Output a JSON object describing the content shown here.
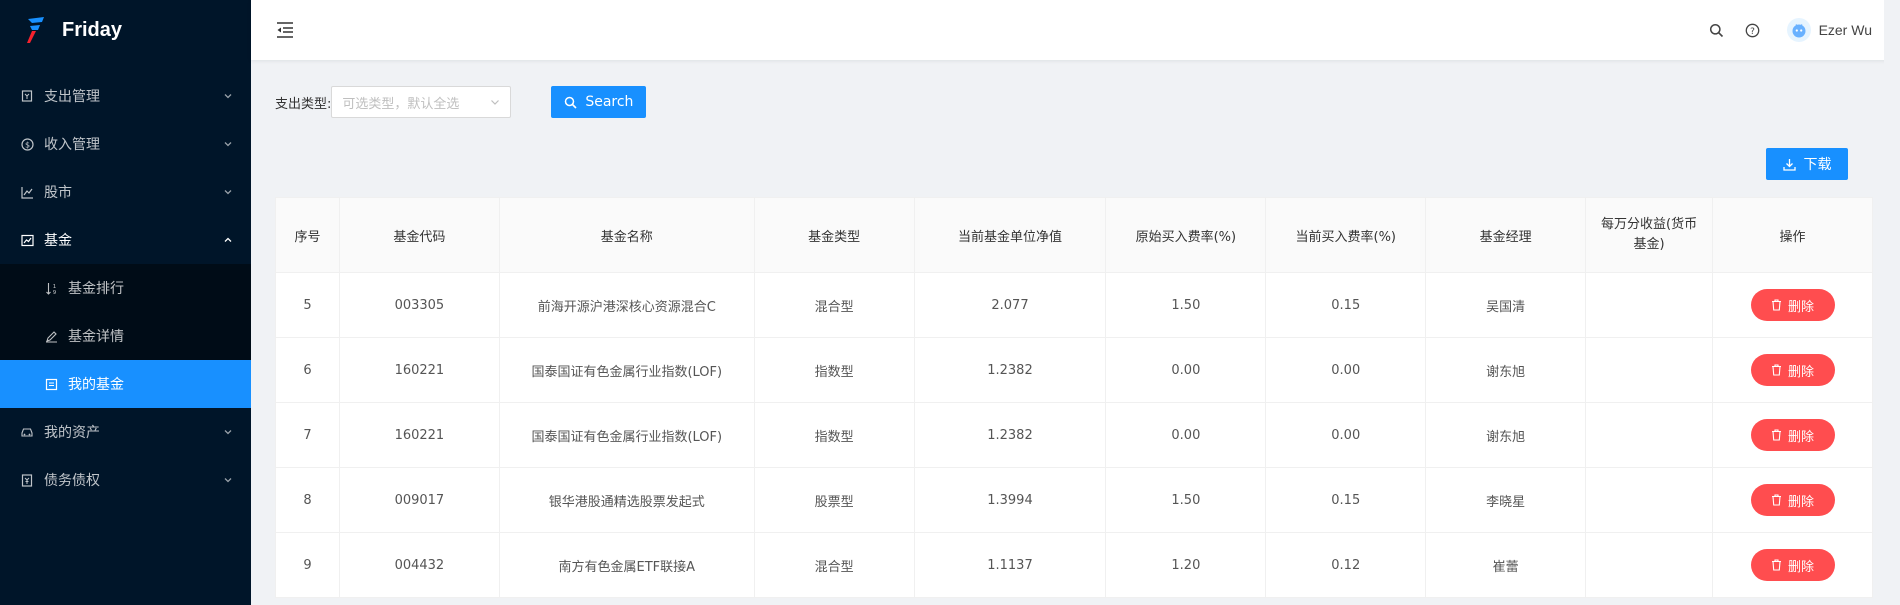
{
  "app": {
    "name": "Friday"
  },
  "sidebar": {
    "items": [
      {
        "label": "支出管理",
        "icon": "receipt-icon"
      },
      {
        "label": "收入管理",
        "icon": "dollar-circle-icon"
      },
      {
        "label": "股市",
        "icon": "line-chart-icon"
      },
      {
        "label": "基金",
        "icon": "fund-chart-icon",
        "open": true,
        "children": [
          {
            "label": "基金排行",
            "icon": "sort-icon"
          },
          {
            "label": "基金详情",
            "icon": "edit-icon"
          },
          {
            "label": "我的基金",
            "icon": "profile-icon",
            "active": true
          }
        ]
      },
      {
        "label": "我的资产",
        "icon": "car-icon"
      },
      {
        "label": "债务债权",
        "icon": "account-book-icon"
      }
    ]
  },
  "header": {
    "user_name": "Ezer Wu"
  },
  "filter": {
    "label": "支出类型:",
    "placeholder": "可选类型，默认全选",
    "search_label": "Search"
  },
  "download_label": "下载",
  "table": {
    "columns": [
      "序号",
      "基金代码",
      "基金名称",
      "基金类型",
      "当前基金单位净值",
      "原始买入费率(%)",
      "当前买入费率(%)",
      "基金经理",
      "每万分收益(货币基金)",
      "操作"
    ],
    "delete_label": "删除",
    "rows": [
      {
        "index": "5",
        "code": "003305",
        "name": "前海开源沪港深核心资源混合C",
        "type": "混合型",
        "nav": "2.077",
        "orig_fee": "1.50",
        "cur_fee": "0.15",
        "manager": "吴国清",
        "yield": ""
      },
      {
        "index": "6",
        "code": "160221",
        "name": "国泰国证有色金属行业指数(LOF)",
        "type": "指数型",
        "nav": "1.2382",
        "orig_fee": "0.00",
        "cur_fee": "0.00",
        "manager": "谢东旭",
        "yield": ""
      },
      {
        "index": "7",
        "code": "160221",
        "name": "国泰国证有色金属行业指数(LOF)",
        "type": "指数型",
        "nav": "1.2382",
        "orig_fee": "0.00",
        "cur_fee": "0.00",
        "manager": "谢东旭",
        "yield": ""
      },
      {
        "index": "8",
        "code": "009017",
        "name": "银华港股通精选股票发起式",
        "type": "股票型",
        "nav": "1.3994",
        "orig_fee": "1.50",
        "cur_fee": "0.15",
        "manager": "李晓星",
        "yield": ""
      },
      {
        "index": "9",
        "code": "004432",
        "name": "南方有色金属ETF联接A",
        "type": "混合型",
        "nav": "1.1137",
        "orig_fee": "1.20",
        "cur_fee": "0.12",
        "manager": "崔蕾",
        "yield": ""
      }
    ]
  }
}
